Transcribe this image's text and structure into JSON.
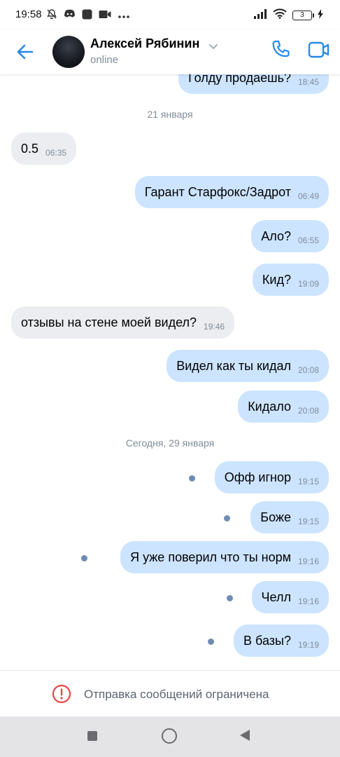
{
  "status_bar": {
    "time": "19:58",
    "battery": "3",
    "icons_left": [
      "mute-bell-icon",
      "discord-icon",
      "app-square-icon",
      "video-record-icon",
      "more-dots-icon"
    ],
    "icons_right": [
      "signal-icon",
      "wifi-icon",
      "battery-icon",
      "charging-icon"
    ]
  },
  "header": {
    "name": "Алексей Рябинин",
    "status": "online",
    "accent_color": "#2688eb"
  },
  "messages": {
    "partial_top": {
      "text": "Голду продаешь?",
      "time": "18:45"
    },
    "date1": "21 января",
    "m1": {
      "text": "0.5",
      "time": "06:35",
      "dir": "in"
    },
    "m2": {
      "text": "Гарант Старфокс/Задрот",
      "time": "06:49",
      "dir": "out"
    },
    "m3": {
      "text": "Ало?",
      "time": "06:55",
      "dir": "out"
    },
    "m4": {
      "text": "Кид?",
      "time": "19:09",
      "dir": "out"
    },
    "m5": {
      "text": "отзывы на стене моей видел?",
      "time": "19:46",
      "dir": "in"
    },
    "m6": {
      "text": "Видел как ты кидал",
      "time": "20:08",
      "dir": "out"
    },
    "m7": {
      "text": "Кидало",
      "time": "20:08",
      "dir": "out"
    },
    "date2": "Сегодня, 29 января",
    "m8": {
      "text": "Офф игнор",
      "time": "19:15",
      "dir": "out",
      "unread": true
    },
    "m9": {
      "text": "Боже",
      "time": "19:15",
      "dir": "out",
      "unread": true
    },
    "m10": {
      "text": "Я уже поверил что ты норм",
      "time": "19:16",
      "dir": "out",
      "unread": true
    },
    "m11": {
      "text": "Челл",
      "time": "19:16",
      "dir": "out",
      "unread": true
    },
    "m12": {
      "text": "В базы?",
      "time": "19:19",
      "dir": "out",
      "unread": true
    }
  },
  "restricted": {
    "text": "Отправка сообщений ограничена",
    "icon": "alert-circle-icon",
    "icon_color": "#e64646"
  },
  "colors": {
    "outgoing_bubble": "#cce4ff",
    "incoming_bubble": "#ebedf0",
    "unread_dot": "#6f8db3"
  }
}
